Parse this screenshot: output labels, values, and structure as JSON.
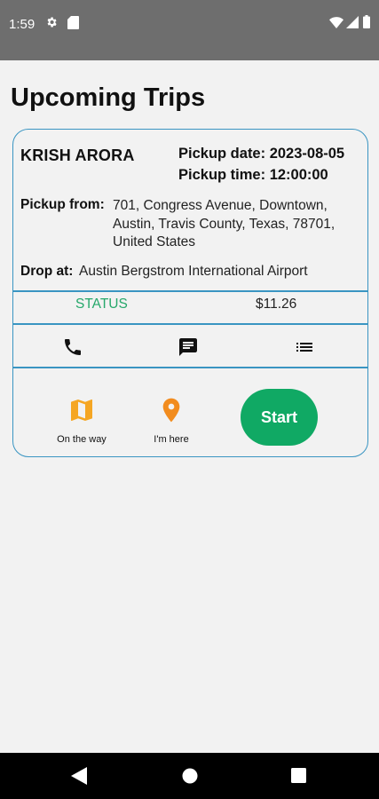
{
  "status_bar": {
    "time": "1:59",
    "icons": [
      "gear-icon",
      "sd-card-icon",
      "wifi-icon",
      "signal-icon",
      "battery-icon"
    ]
  },
  "page": {
    "title": "Upcoming Trips"
  },
  "trip": {
    "passenger": "KRISH ARORA",
    "pickup_date": "Pickup date: 2023-08-05",
    "pickup_time": "Pickup time: 12:00:00",
    "pickup_from_label": "Pickup from:",
    "pickup_from_value": "701, Congress Avenue, Downtown, Austin, Travis County, Texas, 78701, United States",
    "drop_label": "Drop at:",
    "drop_value": "Austin Bergstrom International Airport",
    "status": "STATUS",
    "fare": "$11.26",
    "actions": {
      "on_the_way": "On the way",
      "im_here": "I'm here",
      "start": "Start"
    }
  },
  "colors": {
    "card_border": "#3a95c2",
    "status_green": "#26a86b",
    "start_button": "#10a964",
    "map_icon": "#f5a623",
    "pin_icon": "#f28c1e"
  }
}
